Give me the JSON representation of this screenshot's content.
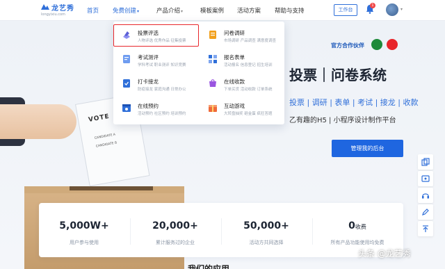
{
  "header": {
    "logo_text": "龙艺秀",
    "logo_sub": "longyixiu.com",
    "nav": [
      {
        "label": "首页",
        "active": true,
        "dropdown": false
      },
      {
        "label": "免费创建",
        "active": false,
        "dropdown": true
      },
      {
        "label": "产品介绍",
        "active": false,
        "dropdown": true
      },
      {
        "label": "模板案例",
        "active": false,
        "dropdown": false
      },
      {
        "label": "活动方案",
        "active": false,
        "dropdown": false
      },
      {
        "label": "帮助与支持",
        "active": false,
        "dropdown": false
      }
    ],
    "workbench_label": "工作台",
    "notification_count": "1"
  },
  "dropdown": {
    "items": [
      {
        "title": "投票评选",
        "desc": "人物评选 优秀作品 征集投票",
        "icon": "vote-icon",
        "color": "#5b5fd6"
      },
      {
        "title": "问卷调研",
        "desc": "市场调研 产品调查 满意度调查",
        "icon": "questionnaire-icon",
        "color": "#f2a11e"
      },
      {
        "title": "考试测评",
        "desc": "学科考试 职业测评 知识竞赛",
        "icon": "exam-icon",
        "color": "#2f6fd9"
      },
      {
        "title": "报名表单",
        "desc": "活动报名 信息登记 招生培训",
        "icon": "form-icon",
        "color": "#2f6fd9"
      },
      {
        "title": "打卡接龙",
        "desc": "防疫接龙 家庭沟通 日常办公",
        "icon": "checkin-icon",
        "color": "#2f6fd9"
      },
      {
        "title": "在线收款",
        "desc": "下单买货 活动收款 订单系统",
        "icon": "payment-icon",
        "color": "#9a55e0"
      },
      {
        "title": "在线预约",
        "desc": "活动预约 社区预约 培训预约",
        "icon": "reservation-icon",
        "color": "#2f6fd9"
      },
      {
        "title": "互动游戏",
        "desc": "大转盘抽奖 砸金蛋 疯狂答题",
        "icon": "game-icon",
        "color": "#f06a3a"
      }
    ]
  },
  "hero": {
    "partner_label": "官方合作伙伴",
    "title": "投票｜问卷系统",
    "links": "投票 | 调研 | 表单 | 考试 | 接龙 | 收款",
    "desc": "乙有趣的H5 | 小程序设计制作平台",
    "manage_button": "管理我的后台"
  },
  "illustration": {
    "vote_text": "VOTE",
    "candidate_a": "CANDIDATE A",
    "candidate_b": "CANDIDATE B"
  },
  "stats": [
    {
      "value": "5,000W",
      "suffix": "+",
      "label": "用户参与使用"
    },
    {
      "value": "20,000",
      "suffix": "+",
      "label": "累计服务过的企业"
    },
    {
      "value": "50,000",
      "suffix": "+",
      "label": "活动方共同选择"
    },
    {
      "value": "0",
      "suffix": "收费",
      "label": "所有产品功能使用均免费"
    }
  ],
  "section_title": "我们的应用",
  "tools": [
    "copy-icon",
    "contact-icon",
    "headset-icon",
    "edit-icon",
    "top-icon"
  ],
  "watermark": "头条 @龙艺秀"
}
